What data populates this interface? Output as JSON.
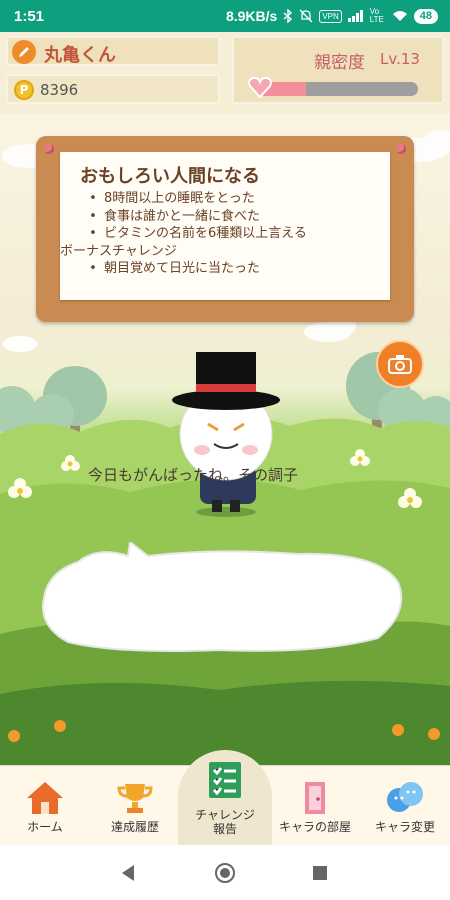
{
  "status_bar": {
    "time": "1:51",
    "speed": "8.9KB/s",
    "vpn": "VPN",
    "network": "Vo LTE",
    "battery": "48"
  },
  "header": {
    "character_name": "丸亀くん",
    "points_coin": "P",
    "points": "8396",
    "intimacy_label": "親密度",
    "level": "Lv.13",
    "intimacy_progress": 0.3
  },
  "challenge_card": {
    "title": "おもしろい人間になる",
    "items": [
      {
        "bullet": true,
        "text": "8時間以上の睡眠をとった"
      },
      {
        "bullet": true,
        "text": "食事は誰かと一緒に食べた"
      },
      {
        "bullet": true,
        "text": "ビタミンの名前を6種類以上言える"
      },
      {
        "bullet": false,
        "text": "ボーナスチャレンジ"
      },
      {
        "bullet": true,
        "text": "朝目覚めて日光に当たった"
      }
    ]
  },
  "speech": "今日もがんばったね。その調子",
  "nav": {
    "home": "ホーム",
    "history": "達成履歴",
    "report_line1": "チャレンジ",
    "report_line2": "報告",
    "room": "キャラの部屋",
    "change": "キャラ変更"
  },
  "colors": {
    "status_bar": "#0ea07e",
    "accent": "#f08028",
    "intimacy": "#c65f6a"
  }
}
